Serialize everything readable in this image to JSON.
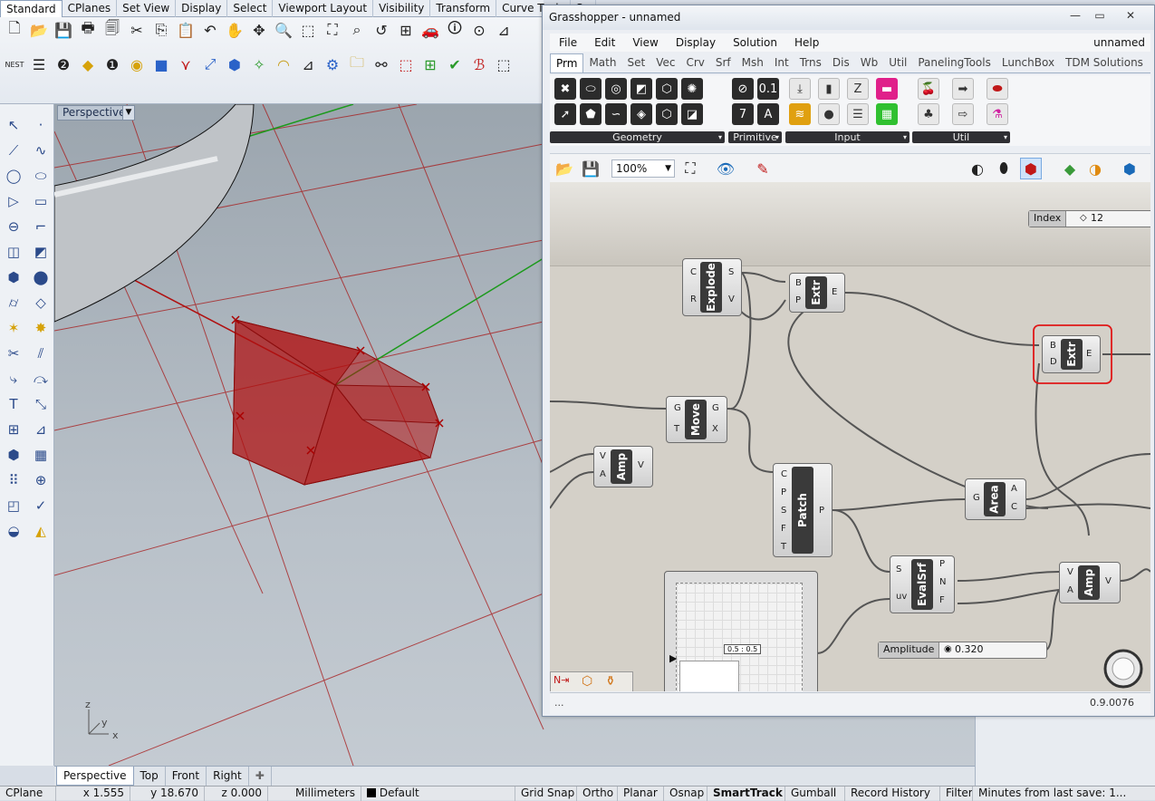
{
  "rhino": {
    "tabs": [
      "Standard",
      "CPlanes",
      "Set View",
      "Display",
      "Select",
      "Viewport Layout",
      "Visibility",
      "Transform",
      "Curve Tools",
      "Su"
    ],
    "active_tab": "Standard",
    "viewport": {
      "label": "Perspective",
      "axis_y": "y",
      "axis_x": "x",
      "axis_z": "z"
    },
    "viewport_tabs": [
      "Perspective",
      "Top",
      "Front",
      "Right"
    ],
    "add_tab_glyph": "✚",
    "status": {
      "cplane": "CPlane",
      "x": "x 1.555",
      "y": "y 18.670",
      "z": "z 0.000",
      "units": "Millimeters",
      "layer": "Default",
      "grid_snap": "Grid Snap",
      "ortho": "Ortho",
      "planar": "Planar",
      "osnap": "Osnap",
      "smarttrack": "SmartTrack",
      "gumball": "Gumball",
      "record_history": "Record History",
      "filter": "Filter",
      "minutes": "Minutes from last save: 1..."
    },
    "colors": {
      "object": "#b01010",
      "axis_green": "#1c9a1c",
      "axis_red": "#b01010"
    }
  },
  "gh": {
    "title": "Grasshopper - unnamed",
    "doc_name": "unnamed",
    "menu": [
      "File",
      "Edit",
      "View",
      "Display",
      "Solution",
      "Help"
    ],
    "tabs": [
      "Prm",
      "Math",
      "Set",
      "Vec",
      "Crv",
      "Srf",
      "Msh",
      "Int",
      "Trns",
      "Dis",
      "Wb",
      "Util",
      "PanelingTools",
      "LunchBox",
      "TDM Solutions"
    ],
    "active_tab": "Prm",
    "panels": [
      "Geometry",
      "Primitive",
      "Input",
      "Util"
    ],
    "zoom": "100%",
    "status_text": "...",
    "version": "0.9.0076",
    "components": {
      "explode": {
        "name": "Explode",
        "in": [
          "C",
          "R"
        ],
        "out": [
          "S",
          "V"
        ]
      },
      "extr1": {
        "name": "Extr",
        "in": [
          "B",
          "P"
        ],
        "out": [
          "E"
        ]
      },
      "extr2": {
        "name": "Extr",
        "in": [
          "B",
          "D"
        ],
        "out": [
          "E"
        ]
      },
      "move": {
        "name": "Move",
        "in": [
          "G",
          "T"
        ],
        "out": [
          "G",
          "X"
        ]
      },
      "amp1": {
        "name": "Amp",
        "in": [
          "V",
          "A"
        ],
        "out": [
          "V"
        ]
      },
      "patch": {
        "name": "Patch",
        "in": [
          "C",
          "P",
          "S",
          "F",
          "T"
        ],
        "out": [
          "P"
        ]
      },
      "area": {
        "name": "Area",
        "in": [
          "G"
        ],
        "out": [
          "A",
          "C"
        ]
      },
      "evalsrf": {
        "name": "EvalSrf",
        "in": [
          "S",
          "uv"
        ],
        "out": [
          "P",
          "N",
          "F"
        ]
      },
      "amp2": {
        "name": "Amp",
        "in": [
          "V",
          "A"
        ],
        "out": [
          "V"
        ]
      }
    },
    "index_slider": {
      "label": "Index",
      "value": "12"
    },
    "amplitude_slider": {
      "label": "Amplitude",
      "value": "0.320"
    },
    "mdslider_value": "0.5 : 0.5"
  }
}
